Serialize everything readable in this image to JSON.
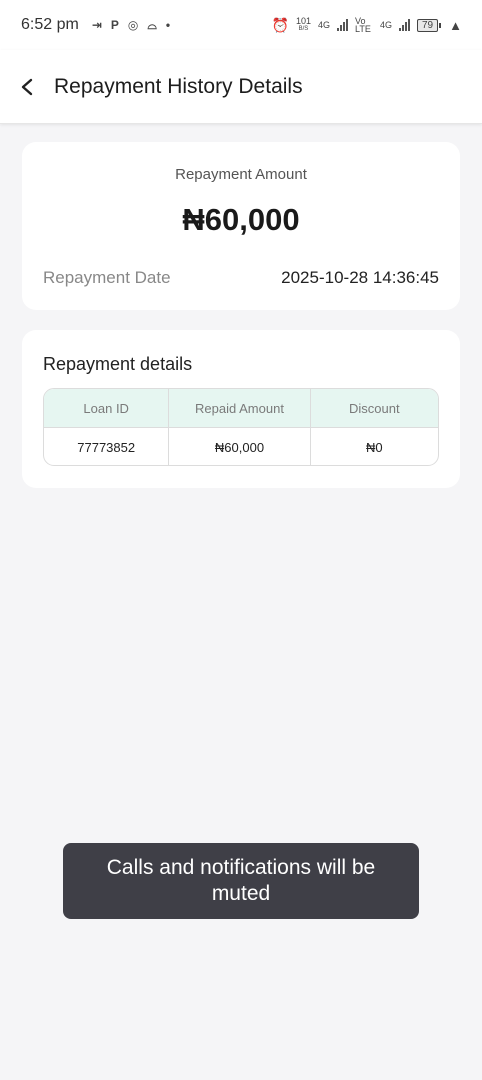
{
  "status_bar": {
    "time": "6:52 pm",
    "left_icons": [
      "⇥",
      "P",
      "◎",
      "⌓",
      "•"
    ],
    "data_speed": "101",
    "data_speed_unit": "B/S",
    "network1": "4G",
    "volte": "Vo LTE",
    "network2": "4G",
    "battery": "79"
  },
  "header": {
    "title": "Repayment History Details",
    "back_icon": "chevron-left-icon"
  },
  "summary": {
    "amount_label": "Repayment Amount",
    "amount_value": "₦60,000",
    "date_label": "Repayment Date",
    "date_value": "2025-10-28 14:36:45"
  },
  "details": {
    "title": "Repayment details",
    "columns": [
      "Loan ID",
      "Repaid Amount",
      "Discount"
    ],
    "rows": [
      [
        "77773852",
        "₦60,000",
        "₦0"
      ]
    ]
  },
  "toast": {
    "message": "Calls and notifications will be muted"
  },
  "colors": {
    "background": "#f5f5f7",
    "table_header": "#e6f6f1",
    "toast_bg": "#3f3f47"
  }
}
